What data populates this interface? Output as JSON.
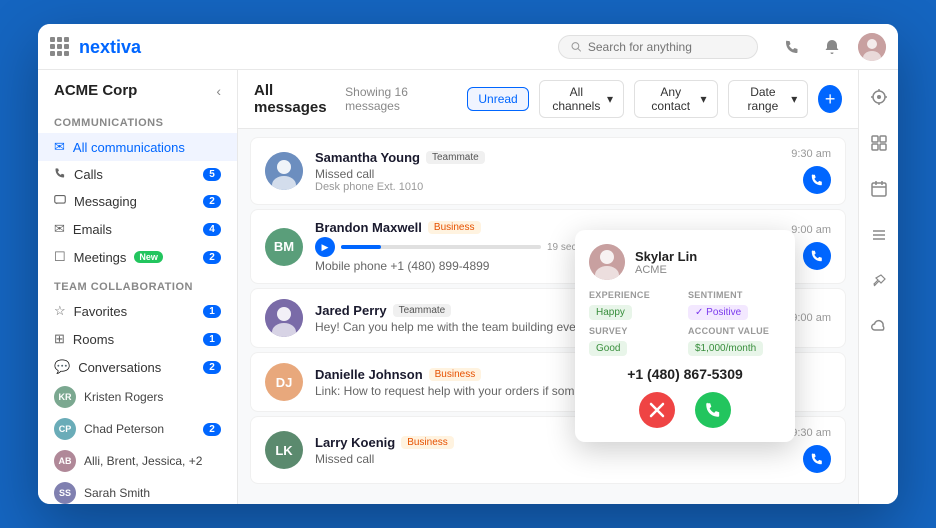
{
  "app": {
    "logo": "nextiva",
    "search_placeholder": "Search for anything"
  },
  "sidebar": {
    "title": "ACME Corp",
    "sections": {
      "communications": {
        "label": "Communications",
        "items": [
          {
            "id": "all-communications",
            "label": "All communications",
            "icon": "✉",
            "active": true,
            "badge": null
          },
          {
            "id": "calls",
            "label": "Calls",
            "icon": "📞",
            "badge": "5"
          },
          {
            "id": "messaging",
            "label": "Messaging",
            "icon": "💬",
            "badge": "2"
          },
          {
            "id": "emails",
            "label": "Emails",
            "icon": "✉",
            "badge": "4"
          },
          {
            "id": "meetings",
            "label": "Meetings",
            "icon": "📋",
            "badge_new": "New",
            "badge": "2"
          }
        ]
      },
      "team_collaboration": {
        "label": "Team collaboration",
        "items": [
          {
            "id": "favorites",
            "label": "Favorites",
            "icon": "☆",
            "badge": "1"
          },
          {
            "id": "rooms",
            "label": "Rooms",
            "icon": "🏠",
            "badge": "1"
          },
          {
            "id": "conversations",
            "label": "Conversations",
            "icon": "💬",
            "badge": "2"
          }
        ]
      },
      "conversations_list": [
        {
          "id": "kristen",
          "name": "Kristen Rogers",
          "color": "#9b7",
          "initials": "KR"
        },
        {
          "id": "chad",
          "name": "Chad Peterson",
          "color": "#7ba",
          "badge": "2",
          "initials": "CP"
        },
        {
          "id": "alli",
          "name": "Alli, Brent, Jessica, +2",
          "color": "#a89",
          "initials": "AB"
        },
        {
          "id": "sarah",
          "name": "Sarah Smith",
          "color": "#88b",
          "initials": "SS"
        }
      ]
    }
  },
  "messages": {
    "title": "All messages",
    "showing": "Showing 16 messages",
    "filters": {
      "unread": "Unread",
      "all_channels": "All channels",
      "any_contact": "Any contact",
      "date_range": "Date range"
    },
    "items": [
      {
        "id": "samantha",
        "name": "Samantha Young",
        "tag": "Teammate",
        "tag_type": "teammate",
        "text": "Missed call",
        "subtext": "Desk phone Ext. 1010",
        "time": "9:30 am",
        "avatar_color": "#6c8ebf",
        "avatar_img": true,
        "has_call_btn": true
      },
      {
        "id": "brandon",
        "name": "Brandon Maxwell",
        "tag": "Business",
        "tag_type": "business",
        "text": "Voicemail",
        "subtext": "Mobile phone +1 (480) 899-4899",
        "time": "9:00 am",
        "avatar_color": "#5a9",
        "avatar_initials": "BM",
        "has_voicemail": true,
        "has_call_btn": true,
        "has_popup": true
      },
      {
        "id": "jared",
        "name": "Jared Perry",
        "tag": "Teammate",
        "tag_type": "teammate",
        "text": "Hey! Can you help me with the team building event?",
        "time": "9:00 am",
        "avatar_color": "#7a6ba8",
        "avatar_img": true,
        "has_call_btn": false
      },
      {
        "id": "danielle",
        "name": "Danielle Johnson",
        "tag": "Business",
        "tag_type": "business",
        "text": "Link: How to request help with your orders if something goes wrong.",
        "time": "",
        "avatar_color": "#e8a87c",
        "avatar_initials": "DJ",
        "has_call_btn": false
      },
      {
        "id": "larry",
        "name": "Larry Koenig",
        "tag": "Business",
        "tag_type": "business",
        "text": "Missed call",
        "time": "9:30 am",
        "avatar_color": "#5b8a6e",
        "avatar_initials": "LK",
        "has_call_btn": true
      }
    ]
  },
  "popup": {
    "name": "Skylar Lin",
    "company": "ACME",
    "experience_label": "EXPERIENCE",
    "experience_value": "Happy",
    "sentiment_label": "SENTIMENT",
    "sentiment_value": "✓ Positive",
    "survey_label": "SURVEY",
    "survey_value": "Good",
    "account_value_label": "ACCOUNT VALUE",
    "account_value": "$1,000/month",
    "phone": "+1 (480) 867-5309",
    "decline_icon": "✕",
    "accept_icon": "✓"
  }
}
